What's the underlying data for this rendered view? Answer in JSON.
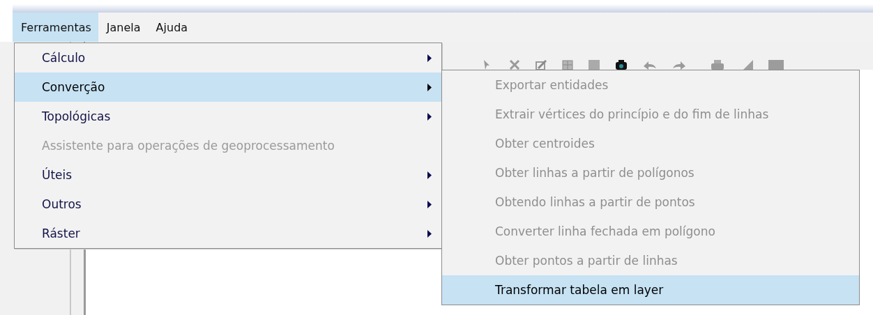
{
  "menubar": [
    {
      "label": "Ferramentas",
      "selected": true
    },
    {
      "label": "Janela",
      "selected": false
    },
    {
      "label": "Ajuda",
      "selected": false
    }
  ],
  "menu": {
    "items": [
      {
        "label": "Cálculo",
        "kind": "submenu",
        "disabled": false,
        "selected": false
      },
      {
        "label": "Converção",
        "kind": "submenu",
        "disabled": false,
        "selected": true
      },
      {
        "label": "Topológicas",
        "kind": "submenu",
        "disabled": false,
        "selected": false
      },
      {
        "label": "Assistente para operações de geoprocessamento",
        "kind": "action",
        "disabled": true,
        "selected": false
      },
      {
        "label": "Úteis",
        "kind": "submenu",
        "disabled": false,
        "selected": false
      },
      {
        "label": "Outros",
        "kind": "submenu",
        "disabled": false,
        "selected": false
      },
      {
        "label": "Ráster",
        "kind": "submenu",
        "disabled": false,
        "selected": false
      }
    ]
  },
  "submenu": {
    "items": [
      {
        "label": "Exportar entidades",
        "disabled": true,
        "selected": false
      },
      {
        "label": "Extrair vértices do princípio e do fim de linhas",
        "disabled": true,
        "selected": false
      },
      {
        "label": "Obter centroides",
        "disabled": true,
        "selected": false
      },
      {
        "label": "Obter linhas a partir de polígonos",
        "disabled": true,
        "selected": false
      },
      {
        "label": "Obtendo linhas a partir de pontos",
        "disabled": true,
        "selected": false
      },
      {
        "label": "Converter linha fechada em polígono",
        "disabled": true,
        "selected": false
      },
      {
        "label": "Obter pontos a partir de linhas",
        "disabled": true,
        "selected": false
      },
      {
        "label": "Transformar tabela em layer",
        "disabled": false,
        "selected": true
      }
    ]
  }
}
